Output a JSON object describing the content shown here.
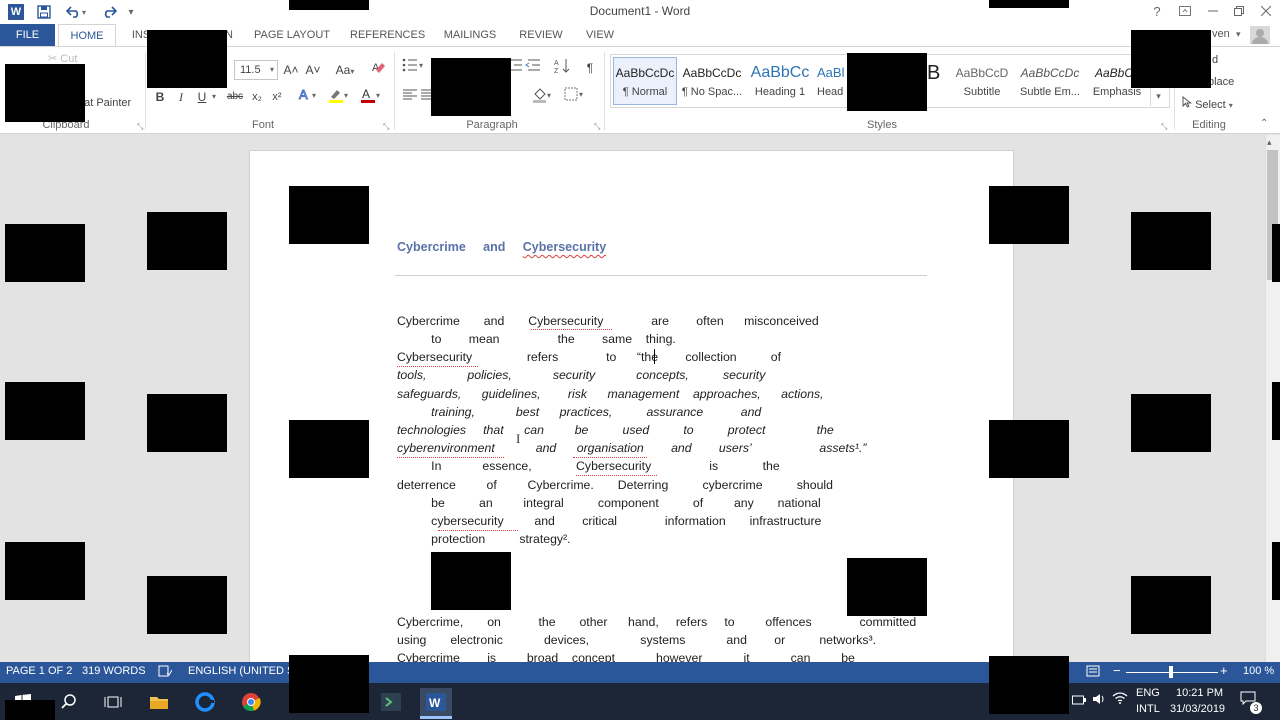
{
  "window": {
    "title": "Document1 - Word",
    "help": "?",
    "user_fragment": "ven"
  },
  "quick_access": {
    "app_icon": "W",
    "save_icon": "save-icon",
    "undo_icon": "undo-icon",
    "redo_icon": "redo-icon",
    "customize_icon": "customize-icon"
  },
  "tabs": {
    "file": "FILE",
    "home": "HOME",
    "insert_fragment": "INS",
    "insert_tail": "N",
    "page_layout": "PAGE LAYOUT",
    "references": "REFERENCES",
    "mailings": "MAILINGS",
    "review": "REVIEW",
    "view": "VIEW"
  },
  "clipboard": {
    "cut": "Cut",
    "format_painter": "nat Painter",
    "label": "Clipboard"
  },
  "font": {
    "size": "11.5",
    "grow": "A˄",
    "shrink": "A˅",
    "change_case": "Aa",
    "bold": "B",
    "italic": "I",
    "underline": "U",
    "strike": "abc",
    "subscript": "x₂",
    "superscript": "x²",
    "label": "Font",
    "accent_color": "#c00000",
    "highlight_color": "#ffff00"
  },
  "paragraph": {
    "pilcrow": "¶",
    "label": "Paragraph"
  },
  "styles": {
    "items": [
      {
        "preview": "AaBbCcDc",
        "name": "¶ Normal"
      },
      {
        "preview": "AaBbCcDc",
        "name": "¶ No Spac..."
      },
      {
        "preview": "AaBbCc",
        "name": "Heading 1"
      },
      {
        "preview": "AaBl",
        "name": "Head"
      },
      {
        "preview": "B",
        "name": ""
      },
      {
        "preview": "AaBbCcD",
        "name": "Subtitle"
      },
      {
        "preview": "AaBbCcDc",
        "name": "Subtle Em..."
      },
      {
        "preview": "AaBbCc",
        "name": "Emphasis"
      }
    ],
    "label": "Styles"
  },
  "editing": {
    "find_fragment": "d",
    "replace_fragment": "place",
    "select": "Select",
    "label": "Editing"
  },
  "document": {
    "title_a": "Cybercrime",
    "title_b": "and",
    "title_c": "Cybersecurity",
    "lines": [
      "Cybercrime       and       Cybersecurity              are        often      misconceived",
      "          to        mean                 the        same    thing.",
      "Cybersecurity                refers              to      “the        collection          of",
      "tools,            policies,            security            concepts,          security",
      "safeguards,      guidelines,        risk      management    approaches,      actions,",
      "          training,            best      practices,          assurance           and",
      "technologies     that      can         be          used          to          protect               the",
      "cyberenvironment            and      organisation        and        users’                    assets¹.”",
      "          In            essence,             Cybersecurity                 is             the",
      "deterrence         of         Cybercrime.       Deterring          cybercrime          should",
      "          be          an         integral          component          of         any       national",
      "          cybersecurity         and        critical              information       infrastructure",
      "          protection          strategy².",
      "Cybercrime,       on           the       other      hand,     refers     to         offences              committed",
      "using       electronic            devices,               systems            and        or          networks³.",
      "Cybercrime        is         broad    concept            however            it            can         be"
    ]
  },
  "status": {
    "page": "PAGE 1 OF 2",
    "words": "319 WORDS",
    "language": "ENGLISH (UNITED STA",
    "zoom_minus": "−",
    "zoom_plus": "+",
    "zoom": "100 %"
  },
  "taskbar": {
    "lang1": "ENG",
    "lang2": "INTL",
    "time": "10:21 PM",
    "date": "31/03/2019",
    "notif_count": "3"
  }
}
